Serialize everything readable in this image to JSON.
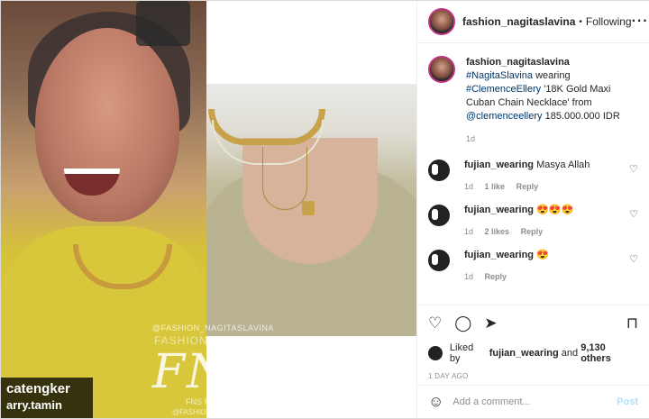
{
  "colors": {
    "link": "#00376b",
    "muted": "#8e8e8e",
    "post_disabled": "#b2dffc",
    "story_ring": "#c13584"
  },
  "media": {
    "tag_name": "catengker",
    "tag_sub": "arry.tamin",
    "watermark_handle": "@FASHION_NAGITASLAVINA",
    "watermark_name": "FASHION NAGITA SLAVINA",
    "watermark_logo": "FNS",
    "watermark_family": "FNS FAMILY",
    "watermark_handle2": "@FASHION_NAGITASLAVINA"
  },
  "header": {
    "username": "fashion_nagitaslavina",
    "separator": "•",
    "follow_label": "Following",
    "more_label": "···"
  },
  "caption": {
    "username": "fashion_nagitaslavina",
    "hashtag1": "#NagitaSlavina",
    "text1": "wearing",
    "hashtag2": "#ClemenceEllery",
    "text2": "'18K Gold Maxi Cuban Chain Necklace' from",
    "mention": "@clemenceellery",
    "text3": "185.000.000 IDR",
    "time": "1d"
  },
  "comments": [
    {
      "username": "fujian_wearing",
      "text": "Masya Allah",
      "time": "1d",
      "likes": "1 like",
      "reply": "Reply"
    },
    {
      "username": "fujian_wearing",
      "text": "😍😍😍",
      "time": "1d",
      "likes": "2 likes",
      "reply": "Reply"
    },
    {
      "username": "fujian_wearing",
      "text": "😍",
      "time": "1d",
      "likes": "",
      "reply": "Reply"
    }
  ],
  "actions": {
    "heart_icon": "heart-icon",
    "comment_icon": "comment-icon",
    "share_icon": "share-icon",
    "save_icon": "bookmark-icon",
    "liked_prefix": "Liked by",
    "liked_user": "fujian_wearing",
    "liked_and": "and",
    "liked_count": "9,130 others",
    "timestamp": "1 DAY AGO"
  },
  "comment_bar": {
    "placeholder": "Add a comment...",
    "post_label": "Post"
  }
}
